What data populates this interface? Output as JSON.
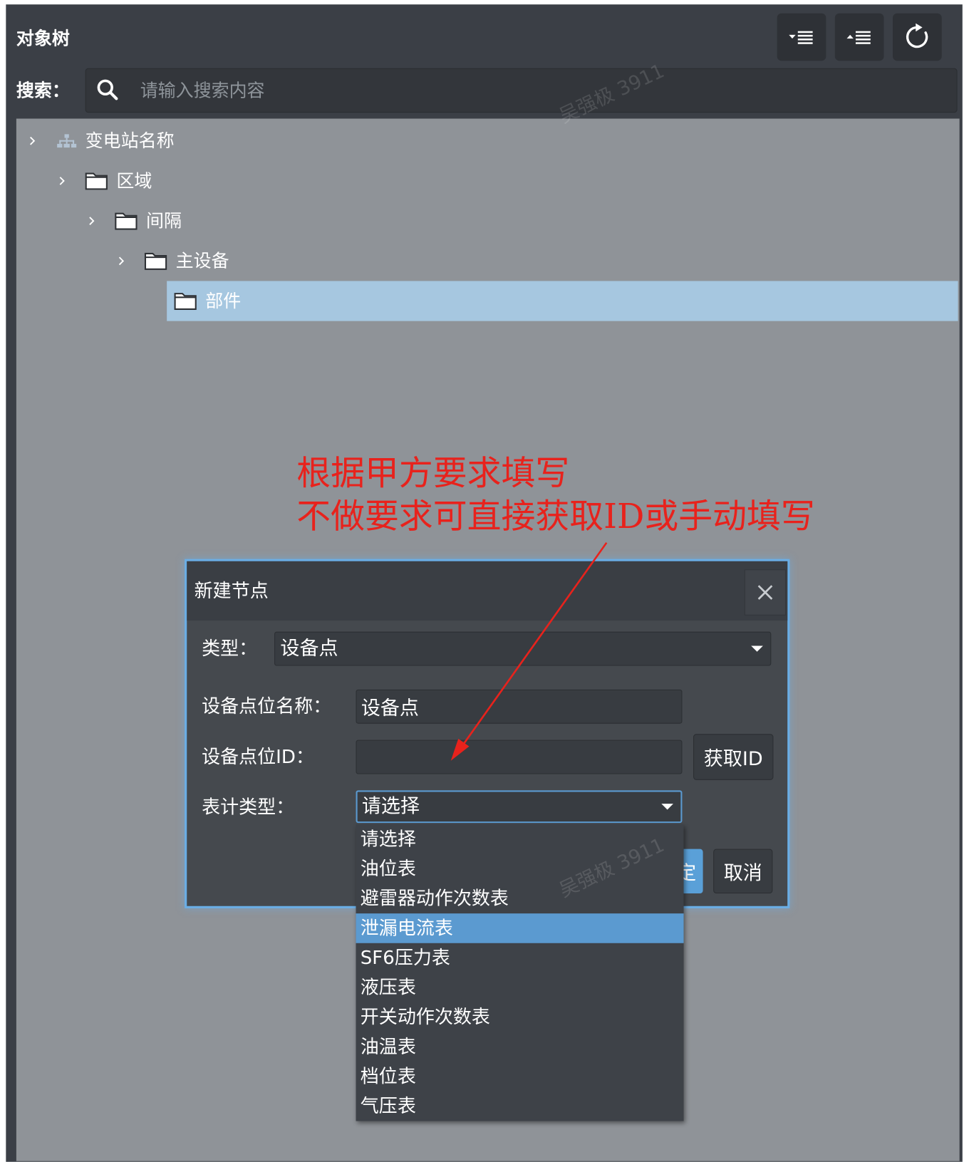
{
  "window": {
    "title": "对象树"
  },
  "toolbar": {
    "buttons": [
      {
        "icon": "expand-all-icon"
      },
      {
        "icon": "collapse-all-icon"
      },
      {
        "icon": "refresh-icon"
      }
    ]
  },
  "search": {
    "label": "搜索：",
    "placeholder": "请输入搜索内容",
    "value": "",
    "icon": "search-icon"
  },
  "tree": {
    "items": [
      {
        "label": "变电站名称",
        "icon": "org-tree-icon",
        "expandable": true,
        "selected": false
      },
      {
        "label": "区域",
        "icon": "folder-icon",
        "expandable": true,
        "selected": false
      },
      {
        "label": "间隔",
        "icon": "folder-icon",
        "expandable": true,
        "selected": false
      },
      {
        "label": "主设备",
        "icon": "folder-icon",
        "expandable": true,
        "selected": false
      },
      {
        "label": "部件",
        "icon": "folder-icon",
        "expandable": false,
        "selected": true
      }
    ]
  },
  "annotation": {
    "lines": [
      "根据甲方要求填写",
      "不做要求可直接获取ID或手动填写"
    ]
  },
  "dialog": {
    "title": "新建节点",
    "close_icon": "close-icon",
    "type": {
      "label": "类型：",
      "value": "设备点"
    },
    "point_name": {
      "label": "设备点位名称：",
      "value": "设备点"
    },
    "point_id": {
      "label": "设备点位ID：",
      "value": "",
      "get_id_label": "获取ID"
    },
    "meter_type": {
      "label": "表计类型：",
      "value": "请选择",
      "options": [
        "请选择",
        "油位表",
        "避雷器动作次数表",
        "泄漏电流表",
        "SF6压力表",
        "液压表",
        "开关动作次数表",
        "油温表",
        "档位表",
        "气压表"
      ],
      "highlighted_index": 3
    },
    "confirm_label": "确定",
    "cancel_label": "取消"
  },
  "watermark": {
    "text": "吴强极 3911"
  },
  "colors": {
    "accent": "#5b9ad0",
    "selection": "#a6c7e0",
    "annotation": "#e8221c",
    "confirm": "#5aa0d8"
  }
}
